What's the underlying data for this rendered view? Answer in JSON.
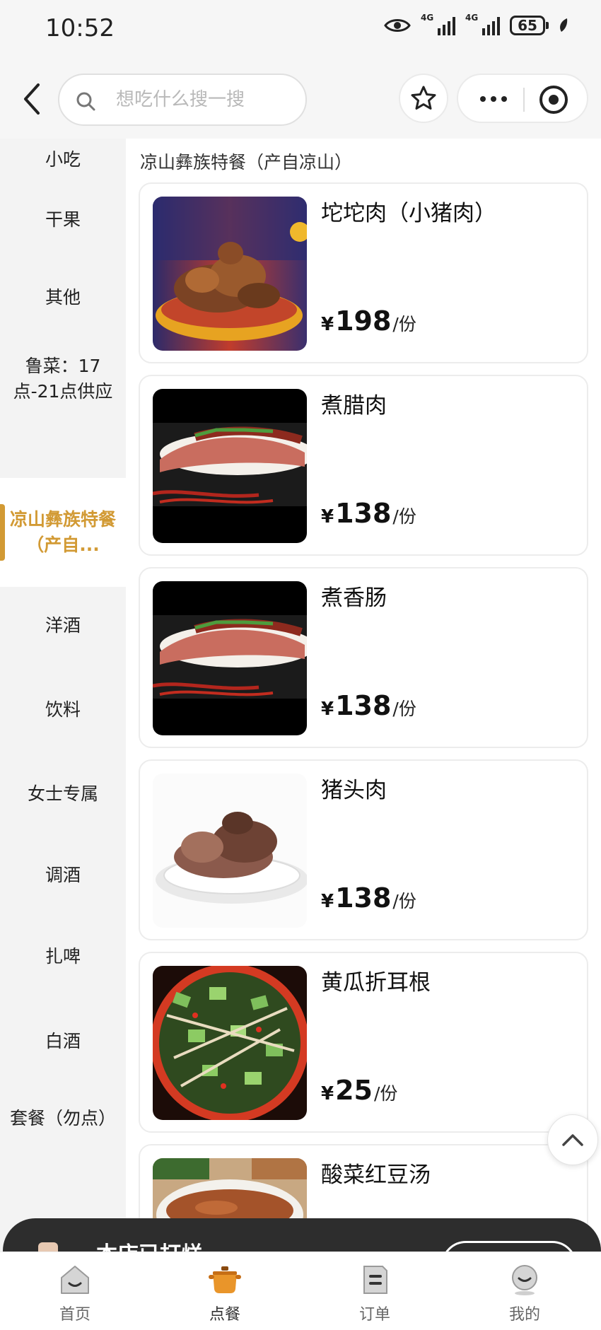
{
  "status_bar": {
    "time": "10:52",
    "network_1": "4G",
    "network_2": "4G",
    "battery": "65"
  },
  "nav": {
    "search_placeholder": "想吃什么搜一搜"
  },
  "sidebar": {
    "categories": [
      {
        "label": "小吃",
        "active": false
      },
      {
        "label": "干果",
        "active": false
      },
      {
        "label": "其他",
        "active": false
      },
      {
        "label": "鲁菜：17点-21点供应",
        "active": false
      },
      {
        "label": "凉山彝族特餐（产自...",
        "active": true
      },
      {
        "label": "洋酒",
        "active": false
      },
      {
        "label": "饮料",
        "active": false
      },
      {
        "label": "女士专属",
        "active": false
      },
      {
        "label": "调酒",
        "active": false
      },
      {
        "label": "扎啤",
        "active": false
      },
      {
        "label": "白酒",
        "active": false
      },
      {
        "label": "套餐（勿点）",
        "active": false
      }
    ],
    "accent_color": "#d29a34"
  },
  "section": {
    "title": "凉山彝族特餐（产自凉山）"
  },
  "dishes": [
    {
      "name": "坨坨肉（小猪肉）",
      "currency": "¥",
      "price": "198",
      "unit": "/份",
      "image": "fried-pork-photo"
    },
    {
      "name": "煮腊肉",
      "currency": "¥",
      "price": "138",
      "unit": "/份",
      "image": "sliced-bacon-photo"
    },
    {
      "name": "煮香肠",
      "currency": "¥",
      "price": "138",
      "unit": "/份",
      "image": "sliced-sausage-photo"
    },
    {
      "name": "猪头肉",
      "currency": "¥",
      "price": "138",
      "unit": "/份",
      "image": "pork-head-photo"
    },
    {
      "name": "黄瓜折耳根",
      "currency": "¥",
      "price": "25",
      "unit": "/份",
      "image": "cucumber-salad-photo"
    },
    {
      "name": "酸菜红豆汤",
      "currency": "¥",
      "price": "",
      "unit": "",
      "image": "bean-soup-photo"
    }
  ],
  "banner": {
    "text": "本店已打烊"
  },
  "tabbar": {
    "tabs": [
      {
        "label": "首页",
        "icon": "home-icon"
      },
      {
        "label": "点餐",
        "icon": "pot-icon",
        "active": true
      },
      {
        "label": "订单",
        "icon": "order-icon"
      },
      {
        "label": "我的",
        "icon": "profile-icon"
      }
    ]
  }
}
